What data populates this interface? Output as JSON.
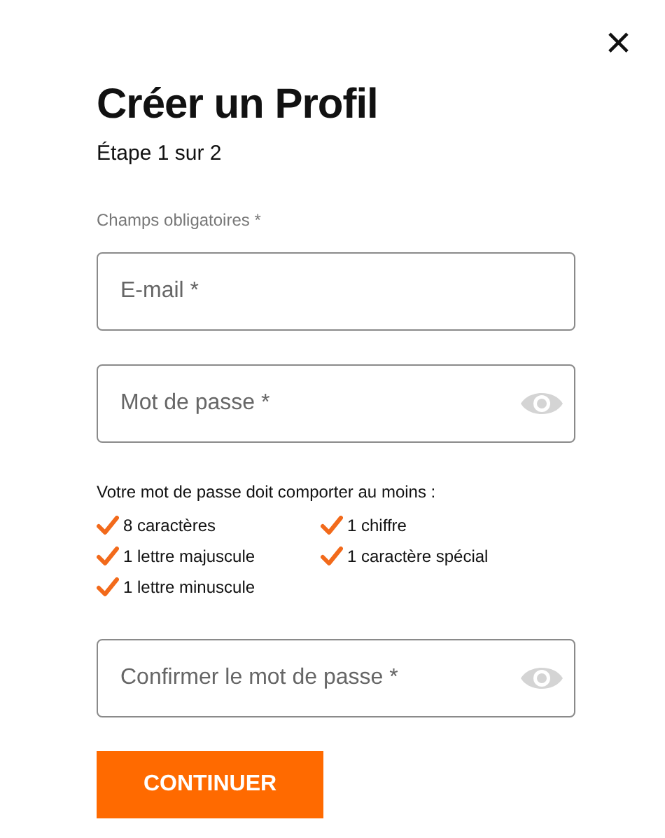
{
  "close": "×",
  "title": "Créer un Profil",
  "step": "Étape 1 sur 2",
  "required_note": "Champs obligatoires *",
  "fields": [
    {
      "kind": "email",
      "placeholder": "E-mail *"
    },
    {
      "kind": "password",
      "placeholder": "Mot de passe *"
    }
  ],
  "rules_intro": "Votre mot de passe doit comporter au moins :",
  "rules": [
    {
      "label": "8 caractères",
      "checked": true
    },
    {
      "label": "1 chiffre",
      "checked": true
    },
    {
      "label": "1 lettre majuscule",
      "checked": true
    },
    {
      "label": "1 caractère spécial",
      "checked": true
    },
    {
      "label": "1 lettre minuscule",
      "checked": true
    }
  ],
  "confirm_field": {
    "kind": "password",
    "placeholder": "Confirmer le mot de passe *"
  },
  "submit": "CONTINUER"
}
